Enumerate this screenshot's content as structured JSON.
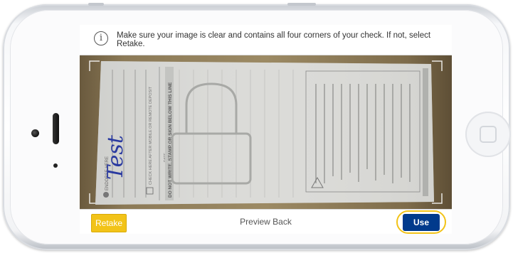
{
  "screen": {
    "message": "Make sure your image is clear and contains all four corners of your check. If not, select Retake.",
    "icons": {
      "info": "info-icon"
    }
  },
  "check": {
    "endorse_label": "ENDORSE HERE",
    "signature": "Test",
    "mobile_deposit_label": "CHECK HERE AFTER MOBILE OR REMOTE DEPOSIT",
    "date_label": "DATE",
    "do_not_write": "DO NOT WRITE, STAMP OR SIGN BELOW THIS LINE"
  },
  "toolbar": {
    "retake_label": "Retake",
    "title": "Preview Back",
    "use_label": "Use"
  },
  "colors": {
    "retake": "#f2c318",
    "use": "#003a8c",
    "highlight_ring": "#f2c318"
  }
}
